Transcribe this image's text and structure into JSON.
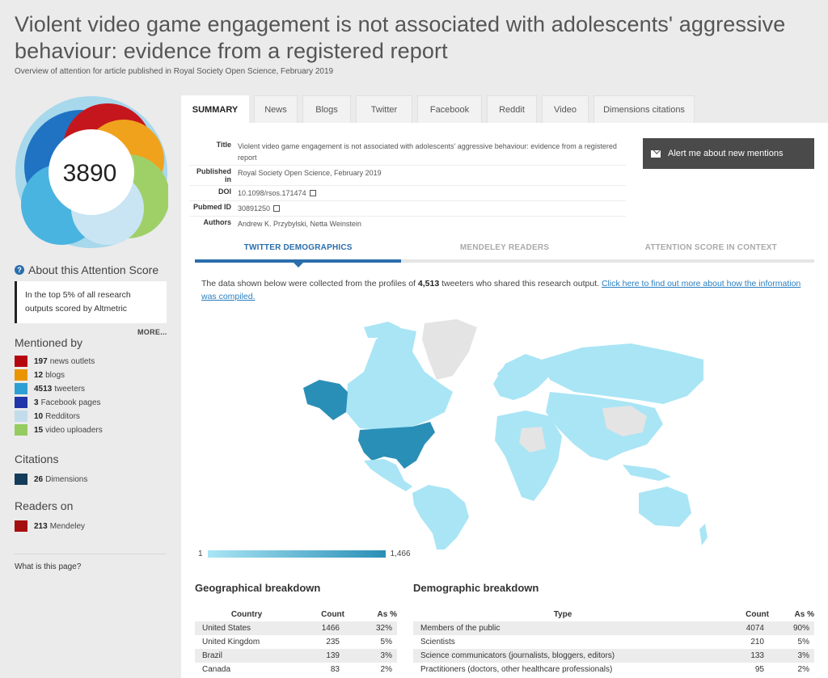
{
  "header": {
    "title": "Violent video game engagement is not associated with adolescents' aggressive behaviour: evidence from a registered report",
    "subtitle": "Overview of attention for article published in Royal Society Open Science, February 2019"
  },
  "sidebar": {
    "score": "3890",
    "about_label": "About this Attention Score",
    "context_text": "In the top 5% of all research outputs scored by Altmetric",
    "more_label": "MORE...",
    "mentioned_by_heading": "Mentioned by",
    "mentions": [
      {
        "count": "197",
        "label": "news outlets",
        "color": "#b5070f"
      },
      {
        "count": "12",
        "label": "blogs",
        "color": "#e89500"
      },
      {
        "count": "4513",
        "label": "tweeters",
        "color": "#2e9fd3"
      },
      {
        "count": "3",
        "label": "Facebook pages",
        "color": "#2136a8"
      },
      {
        "count": "10",
        "label": "Redditors",
        "color": "#c2dcec"
      },
      {
        "count": "15",
        "label": "video uploaders",
        "color": "#96cc5f"
      }
    ],
    "citations_heading": "Citations",
    "citations": [
      {
        "count": "26",
        "label": "Dimensions",
        "color": "#123c5a"
      }
    ],
    "readers_heading": "Readers on",
    "readers": [
      {
        "count": "213",
        "label": "Mendeley",
        "color": "#a50f0f"
      }
    ],
    "what_link": "What is this page?"
  },
  "tabs": [
    "SUMMARY",
    "News",
    "Blogs",
    "Twitter",
    "Facebook",
    "Reddit",
    "Video",
    "Dimensions citations"
  ],
  "meta": {
    "title_label": "Title",
    "title_value": "Violent video game engagement is not associated with adolescents' aggressive behaviour: evidence from a registered report",
    "published_label": "Published in",
    "published_value": "Royal Society Open Science, February 2019",
    "doi_label": "DOI",
    "doi_value": "10.1098/rsos.171474",
    "pubmed_label": "Pubmed ID",
    "pubmed_value": "30891250",
    "authors_label": "Authors",
    "authors_value": "Andrew K. Przybylski, Netta Weinstein"
  },
  "alert_button": "Alert me about new mentions",
  "subtabs": [
    "TWITTER DEMOGRAPHICS",
    "MENDELEY READERS",
    "ATTENTION SCORE IN CONTEXT"
  ],
  "intro": {
    "prefix": "The data shown below were collected from the profiles of ",
    "count": "4,513",
    "suffix": " tweeters who shared this research output. ",
    "link": "Click here to find out more about how the information was compiled."
  },
  "legend": {
    "min": "1",
    "max": "1,466"
  },
  "geo": {
    "title": "Geographical breakdown",
    "headers": [
      "Country",
      "Count",
      "As %"
    ],
    "rows": [
      [
        "United States",
        "1466",
        "32%"
      ],
      [
        "United Kingdom",
        "235",
        "5%"
      ],
      [
        "Brazil",
        "139",
        "3%"
      ],
      [
        "Canada",
        "83",
        "2%"
      ]
    ]
  },
  "demo": {
    "title": "Demographic breakdown",
    "headers": [
      "Type",
      "Count",
      "As %"
    ],
    "rows": [
      [
        "Members of the public",
        "4074",
        "90%"
      ],
      [
        "Scientists",
        "210",
        "5%"
      ],
      [
        "Science communicators (journalists, bloggers, editors)",
        "133",
        "3%"
      ],
      [
        "Practitioners (doctors, other healthcare professionals)",
        "95",
        "2%"
      ]
    ]
  },
  "colors": {
    "accent": "#2a6eab",
    "map_light": "#a9e5f5",
    "map_dark": "#2a8fb6",
    "map_none": "#e4e4e4"
  }
}
